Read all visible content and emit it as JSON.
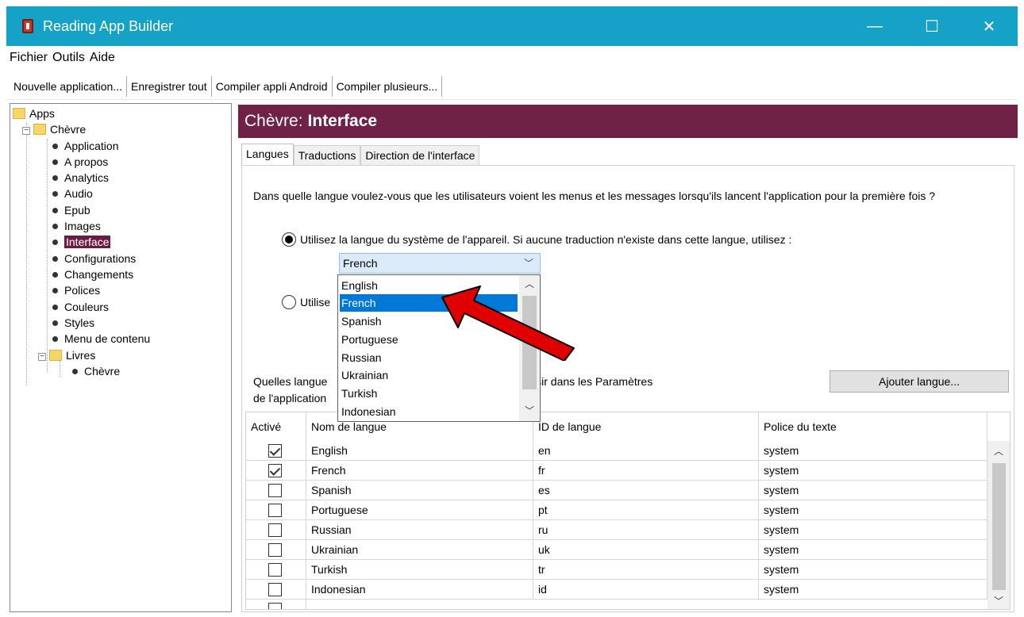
{
  "window": {
    "title": "Reading App Builder",
    "minimize": "—",
    "maximize": "☐",
    "close": "✕"
  },
  "menu": [
    "Fichier",
    "Outils",
    "Aide"
  ],
  "toolbar": [
    "Nouvelle application...",
    "Enregistrer tout",
    "Compiler appli Android",
    "Compiler plusieurs..."
  ],
  "tree": {
    "root": "Apps",
    "app": "Chèvre",
    "items": [
      "Application",
      "A propos",
      "Analytics",
      "Audio",
      "Epub",
      "Images",
      "Interface",
      "Configurations",
      "Changements",
      "Polices",
      "Couleurs",
      "Styles",
      "Menu de contenu"
    ],
    "selected": "Interface",
    "books_folder": "Livres",
    "books": [
      "Chèvre"
    ]
  },
  "header": {
    "prefix": "Chèvre:",
    "title": "Interface"
  },
  "tabs": [
    "Langues",
    "Traductions",
    "Direction de l'interface"
  ],
  "interface": {
    "question": "Dans quelle langue voulez-vous que les utilisateurs voient les menus et les messages lorsqu'ils lancent l'application pour la première fois ?",
    "option1": "Utilisez la langue du système de l'appareil. Si aucune traduction n'existe dans cette langue, utilisez :",
    "option2": "Utilise",
    "combo_value": "French",
    "dropdown_options": [
      "English",
      "French",
      "Spanish",
      "Portuguese",
      "Russian",
      "Ukrainian",
      "Turkish",
      "Indonesian"
    ],
    "question2_left_l1": "Quelles langue",
    "question2_right_l1": "tilisateurs puissent choisir dans les Paramètres",
    "question2_left_l2": "de l'application",
    "add_button": "Ajouter langue..."
  },
  "table": {
    "headers": [
      "Activé",
      "Nom de langue",
      "ID de langue",
      "Police du texte"
    ],
    "rows": [
      {
        "active": true,
        "name": "English",
        "id": "en",
        "font": "system"
      },
      {
        "active": true,
        "name": "French",
        "id": "fr",
        "font": "system"
      },
      {
        "active": false,
        "name": "Spanish",
        "id": "es",
        "font": "system"
      },
      {
        "active": false,
        "name": "Portuguese",
        "id": "pt",
        "font": "system"
      },
      {
        "active": false,
        "name": "Russian",
        "id": "ru",
        "font": "system"
      },
      {
        "active": false,
        "name": "Ukrainian",
        "id": "uk",
        "font": "system"
      },
      {
        "active": false,
        "name": "Turkish",
        "id": "tr",
        "font": "system"
      },
      {
        "active": false,
        "name": "Indonesian",
        "id": "id",
        "font": "system"
      }
    ]
  },
  "colors": {
    "titlebar": "#16a2c6",
    "header": "#6f2146",
    "selection": "#0078d7",
    "arrow": "#e00000"
  }
}
